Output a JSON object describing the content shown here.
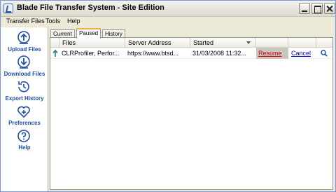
{
  "window": {
    "title": "Blade File Transfer System - Site Edition"
  },
  "menu": {
    "items": [
      "Transfer Files",
      "Tools",
      "Help"
    ]
  },
  "sidebar": {
    "items": [
      {
        "label": "Upload Files",
        "icon": "upload-icon"
      },
      {
        "label": "Download Files",
        "icon": "download-icon"
      },
      {
        "label": "Export History",
        "icon": "export-history-icon"
      },
      {
        "label": "Preferences",
        "icon": "preferences-icon"
      },
      {
        "label": "Help",
        "icon": "help-icon"
      }
    ]
  },
  "tabs": {
    "items": [
      "Current",
      "Paused",
      "History"
    ],
    "active": "Paused"
  },
  "grid": {
    "headers": [
      "Files",
      "Server Address",
      "Started"
    ],
    "rows": [
      {
        "file": "CLRProfiler, Perfor...",
        "server": "https://www.btsd...",
        "started": "31/03/2008 11:32...",
        "resume": "Resume",
        "cancel": "Cancel"
      }
    ]
  },
  "colors": {
    "link_blue": "#0000cc",
    "link_red": "#cc0000",
    "sidebar_label": "#1f4fa8"
  }
}
